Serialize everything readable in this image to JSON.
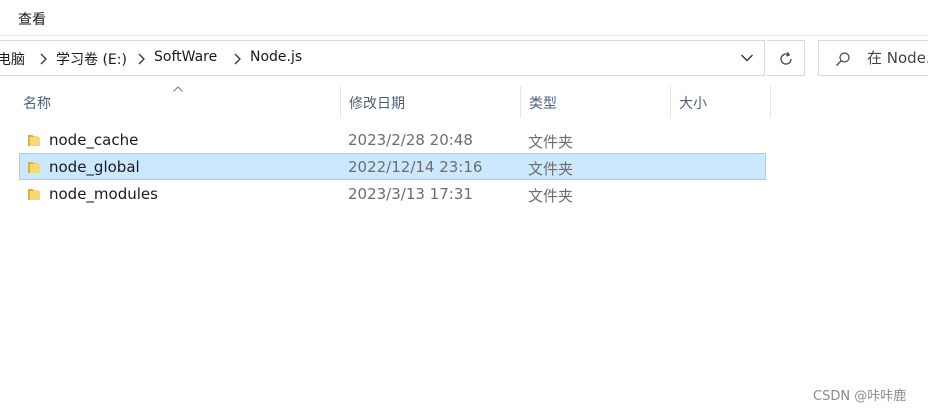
{
  "ribbon": {
    "view_tab": "查看"
  },
  "address_bar": {
    "crumbs": [
      "电脑",
      "学习卷 (E:)",
      "SoftWare",
      "Node.js"
    ],
    "separator_icon": "chevron-right-icon",
    "dropdown_icon": "chevron-down-icon"
  },
  "refresh": {
    "icon": "refresh-icon"
  },
  "search": {
    "placeholder": "在 Node.js 中搜索",
    "icon": "search-icon"
  },
  "columns": {
    "name": "名称",
    "modified": "修改日期",
    "type": "类型",
    "size": "大小",
    "sort_indicator": "sort-ascending-icon"
  },
  "files": [
    {
      "name": "node_cache",
      "modified": "2023/2/28 20:48",
      "type": "文件夹",
      "size": "",
      "selected": false
    },
    {
      "name": "node_global",
      "modified": "2022/12/14 23:16",
      "type": "文件夹",
      "size": "",
      "selected": true
    },
    {
      "name": "node_modules",
      "modified": "2023/3/13 17:31",
      "type": "文件夹",
      "size": "",
      "selected": false
    }
  ],
  "colors": {
    "selection_fill": "#cce8ff",
    "selection_border": "#99d1ff",
    "header_text": "#4c607a",
    "folder_yellow": "#f8d775"
  },
  "watermark": "CSDN @咔咔鹿"
}
